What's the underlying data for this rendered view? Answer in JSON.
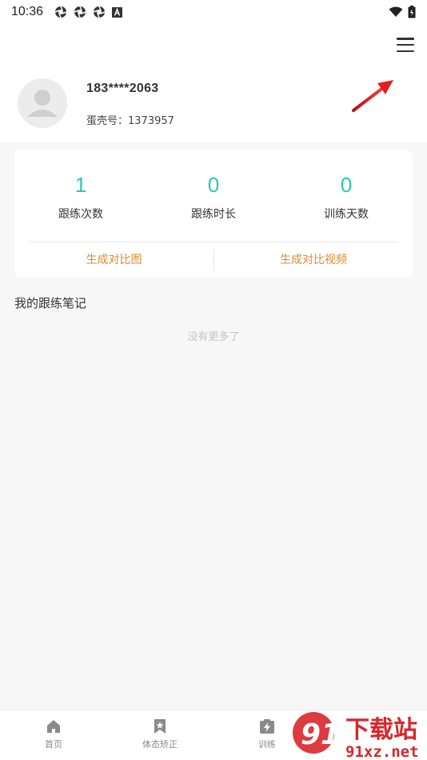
{
  "status_bar": {
    "time": "10:36",
    "notification_icons": [
      "aperture-icon",
      "aperture-icon",
      "aperture-icon",
      "a-box-icon"
    ],
    "right_icons": [
      "wifi-icon",
      "battery-icon"
    ]
  },
  "header": {
    "menu_icon": "hamburger-menu-icon",
    "annotation": "red-arrow-pointer",
    "phone": "183****2063",
    "eggshell_id": "蛋壳号：1373957"
  },
  "stats": [
    {
      "value": "1",
      "label": "跟练次数"
    },
    {
      "value": "0",
      "label": "跟练时长"
    },
    {
      "value": "0",
      "label": "训练天数"
    }
  ],
  "actions": {
    "compare_image": "生成对比图",
    "compare_video": "生成对比视频"
  },
  "notes": {
    "title": "我的跟练笔记",
    "empty_text": "没有更多了"
  },
  "bottom_nav": [
    {
      "label": "首页",
      "icon": "home-icon"
    },
    {
      "label": "体态矫正",
      "icon": "bookmark-star-icon"
    },
    {
      "label": "训练",
      "icon": "bolt-clipboard-icon"
    }
  ],
  "watermark": {
    "text_top": "下载站",
    "text_bottom": "91xz.net"
  },
  "colors": {
    "accent_teal": "#2bc8b3",
    "action_orange": "#e08a2c",
    "background": "#f7f7f8",
    "watermark_red": "#d9262b"
  }
}
